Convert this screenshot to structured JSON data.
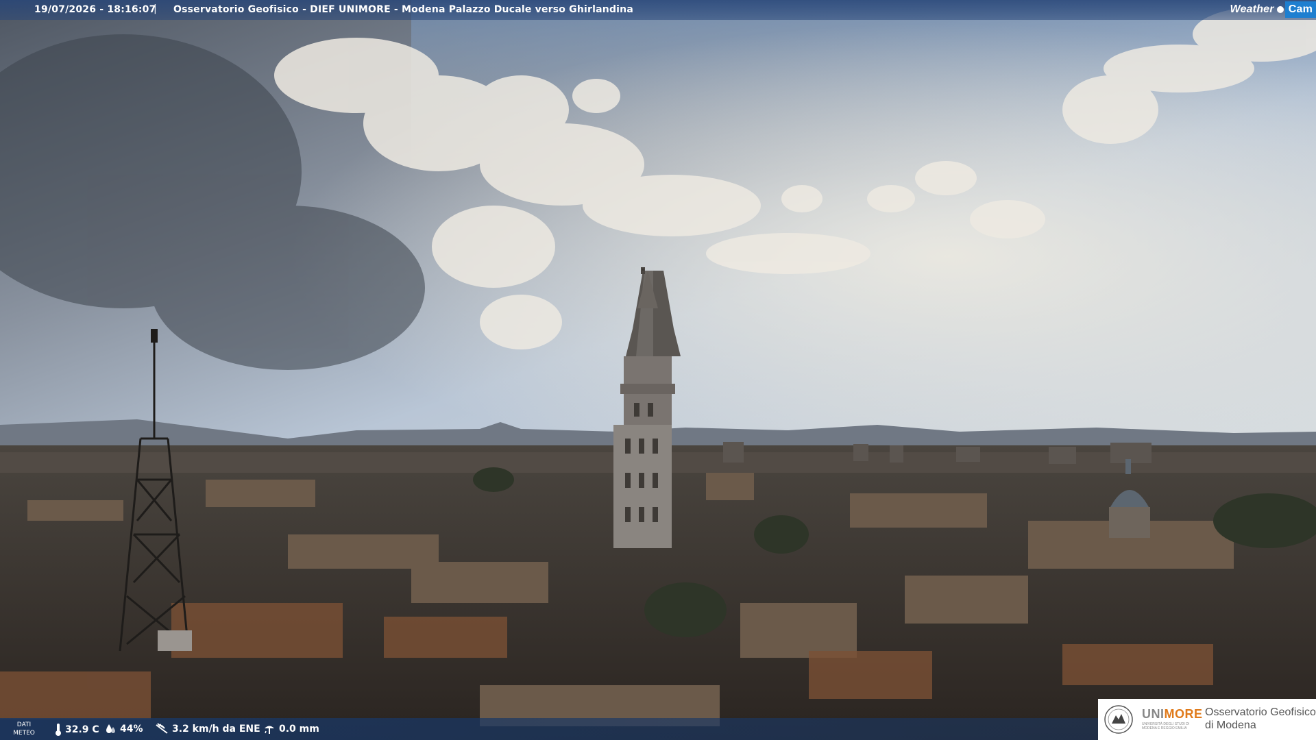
{
  "overlay": {
    "timestamp": "19/07/2026 - 18:16:07",
    "separator": "|",
    "camera_title": "Osservatorio Geofisico - DIEF UNIMORE - Modena Palazzo Ducale verso Ghirlandina",
    "brand_weather": "Weather",
    "brand_cam": "Cam"
  },
  "weather": {
    "label_line1": "DATI",
    "label_line2": "METEO",
    "temperature": "32.9 C",
    "humidity": "44%",
    "wind": "3.2 km/h da ENE",
    "rain": "0.0 mm"
  },
  "logo": {
    "uni_a": "UNI",
    "uni_b": "MORE",
    "sub": "UNIVERSITÀ DEGLI STUDI DI MODENA E REGGIO EMILIA",
    "obs_line1": "Osservatorio Geofisico",
    "obs_line2": "di Modena"
  },
  "colors": {
    "bar": "#1c3764",
    "accent": "#e07a1a",
    "cam": "#1e7fd0"
  },
  "icons": [
    "thermometer-icon",
    "droplet-icon",
    "wind-icon",
    "rain-gauge-icon",
    "university-seal-icon"
  ]
}
